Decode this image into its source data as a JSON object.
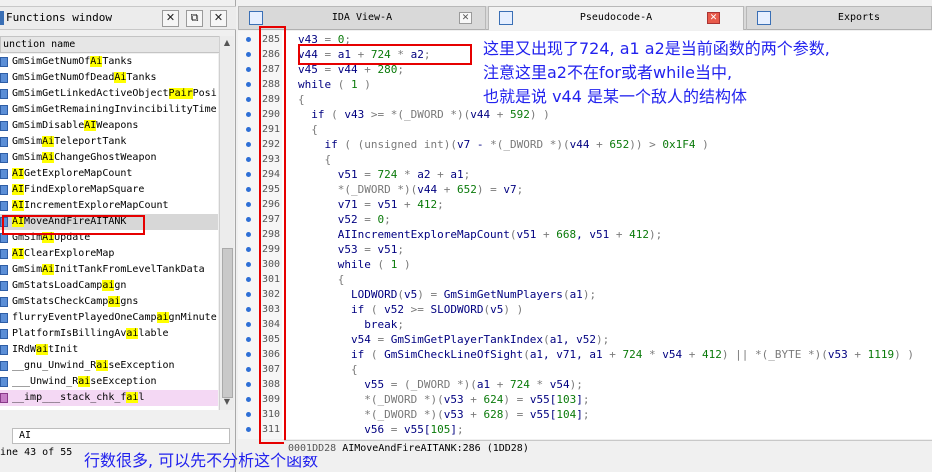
{
  "functions_window": {
    "title": "Functions window",
    "column_header": "unction name",
    "items": [
      [
        "GmSimGetNumOf",
        "Ai",
        "Tanks"
      ],
      [
        "GmSimGetNumOfDead",
        "Ai",
        "Tanks"
      ],
      [
        "GmSimGetLinkedActiveObject",
        "Pair",
        "Posi"
      ],
      [
        "GmSimGetRemainingInvincibilityTime",
        "",
        ""
      ],
      [
        "GmSimDisable",
        "AI",
        "Weapons"
      ],
      [
        "GmSim",
        "Ai",
        "TeleportTank"
      ],
      [
        "GmSim",
        "Ai",
        "ChangeGhostWeapon"
      ],
      [
        "",
        "AI",
        "GetExploreMapCount"
      ],
      [
        "",
        "AI",
        "FindExploreMapSquare"
      ],
      [
        "",
        "AI",
        "IncrementExploreMapCount"
      ],
      [
        "",
        "AI",
        "MoveAndFireAITANK"
      ],
      [
        "GmSim",
        "Ai",
        "Update"
      ],
      [
        "",
        "AI",
        "ClearExploreMap"
      ],
      [
        "GmSim",
        "Ai",
        "InitTankFromLevelTankData"
      ],
      [
        "GmStatsLoadCamp",
        "ai",
        "gn"
      ],
      [
        "GmStatsCheckCamp",
        "ai",
        "gns"
      ],
      [
        "flurryEventPlayedOneCamp",
        "ai",
        "gnMinute"
      ],
      [
        "PlatformIsBillingAv",
        "ai",
        "lable"
      ],
      [
        "IRdW",
        "ai",
        "tInit"
      ],
      [
        "__gnu_Unwind_R",
        "ai",
        "seException"
      ],
      [
        "___Unwind_R",
        "ai",
        "seException"
      ],
      [
        "__imp___stack_chk_f",
        "ai",
        "l"
      ]
    ],
    "selected_index": 10,
    "import_index": 21,
    "filter_value": "AI",
    "status": "ine 43 of 55"
  },
  "tabs": [
    {
      "label": "IDA View-A"
    },
    {
      "label": "Pseudocode-A"
    },
    {
      "label": "Exports"
    }
  ],
  "code": {
    "line_numbers": [
      "285",
      "286",
      "287",
      "288",
      "289",
      "290",
      "291",
      "292",
      "293",
      "294",
      "295",
      "296",
      "297",
      "298",
      "299",
      "300",
      "301",
      "302",
      "303",
      "304",
      "305",
      "306",
      "307",
      "308",
      "309",
      "310",
      "311"
    ],
    "lines": [
      "v43 = 0;",
      "v44 = a1 + 724 * a2;",
      "v45 = v44 + 280;",
      "while ( 1 )",
      "{",
      "  if ( v43 >= *(_DWORD *)(v44 + 592) )",
      "  {",
      "    if ( (unsigned int)(v7 - *(_DWORD *)(v44 + 652)) > 0x1F4 )",
      "    {",
      "      v51 = 724 * a2 + a1;",
      "      *(_DWORD *)(v44 + 652) = v7;",
      "      v71 = v51 + 412;",
      "      v52 = 0;",
      "      AIIncrementExploreMapCount(v51 + 668, v51 + 412);",
      "      v53 = v51;",
      "      while ( 1 )",
      "      {",
      "        LODWORD(v5) = GmSimGetNumPlayers(a1);",
      "        if ( v52 >= SLODWORD(v5) )",
      "          break;",
      "        v54 = GmSimGetPlayerTankIndex(a1, v52);",
      "        if ( GmSimCheckLineOfSight(a1, v71, a1 + 724 * v54 + 412) || *(_BYTE *)(v53 + 1119) )",
      "        {",
      "          v55 = (_DWORD *)(a1 + 724 * v54);",
      "          *(_DWORD *)(v53 + 624) = v55[103];",
      "          *(_DWORD *)(v53 + 628) = v55[104];",
      "          v56 = v55[105];"
    ],
    "status_address": "0001DD28",
    "status_location": "AIMoveAndFireAITANK:286 (1DD28)"
  },
  "annotations": {
    "top_line1": "这里又出现了724, a1 a2是当前函数的两个参数,",
    "top_line2": "注意这里a2不在for或者while当中,",
    "top_line3": "也就是说 v44 是某一个敌人的结构体",
    "bottom": "行数很多, 可以先不分析这个函数"
  },
  "colors": {
    "annotation": "#2222ee",
    "highlight_box": "#e60000",
    "search_highlight": "#ffff00",
    "code_text": "#000080"
  }
}
